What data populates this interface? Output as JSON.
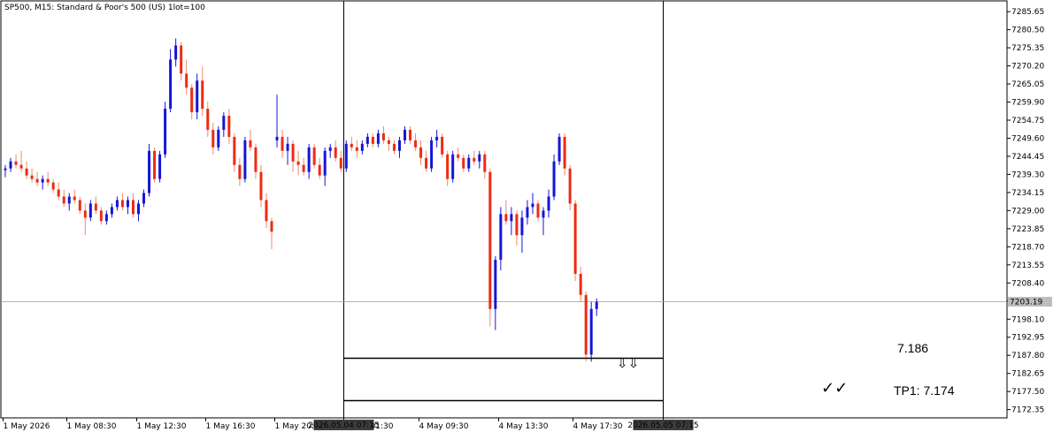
{
  "header": {
    "title": "SP500, M15:  Standard & Poor's 500 (US) 1lot=100"
  },
  "chart_data": {
    "type": "candlestick",
    "timeframe": "M15",
    "ylim": [
      7170.0,
      7288.7
    ],
    "y_ticks": [
      "7285.65",
      "7280.50",
      "7275.35",
      "7270.20",
      "7265.05",
      "7259.90",
      "7254.75",
      "7249.60",
      "7244.45",
      "7239.30",
      "7234.15",
      "7229.00",
      "7223.85",
      "7218.70",
      "7213.55",
      "7208.40",
      "7203.25",
      "7198.10",
      "7192.95",
      "7187.80",
      "7182.65",
      "7177.50",
      "7172.35"
    ],
    "x_ticks": [
      "1 May 2026",
      "1 May 08:30",
      "1 May 12:30",
      "1 May 16:30",
      "1 May 20:30",
      "4 May 01:30",
      "2026.05.04 07:15",
      "4 May 09:30",
      "4 May 13:30",
      "4 May 17:30",
      "2026.05.05 07:15"
    ],
    "current_price": "7203.19",
    "annotations": {
      "level_label": "7.186",
      "tp_label": "TP1: 7.174",
      "checkmarks": "✓✓",
      "arrows": "⇩⇩"
    },
    "levels": {
      "entry": 7187.0,
      "tp1": 7175.0
    },
    "colors": {
      "bull": "#1515d8",
      "bear": "#ee2b12",
      "bear_wick": "#ee8a6a",
      "axis": "#000000"
    },
    "candles": [
      [
        7240.5,
        7242,
        7238.5,
        7241
      ],
      [
        7241,
        7244,
        7240,
        7243
      ],
      [
        7243,
        7245,
        7241,
        7242
      ],
      [
        7242,
        7246,
        7240,
        7241
      ],
      [
        7241,
        7243,
        7238,
        7239
      ],
      [
        7239,
        7241,
        7237,
        7238
      ],
      [
        7238,
        7240,
        7236,
        7237
      ],
      [
        7237,
        7239,
        7235,
        7238
      ],
      [
        7238,
        7240,
        7236,
        7237
      ],
      [
        7237,
        7238,
        7234,
        7235
      ],
      [
        7235,
        7237,
        7232,
        7233
      ],
      [
        7233,
        7235,
        7230,
        7231
      ],
      [
        7231,
        7234,
        7229,
        7233
      ],
      [
        7233,
        7235,
        7231,
        7232
      ],
      [
        7232,
        7233,
        7228,
        7229
      ],
      [
        7229,
        7231,
        7222,
        7227
      ],
      [
        7227,
        7232,
        7226,
        7231
      ],
      [
        7231,
        7233,
        7228,
        7229
      ],
      [
        7229,
        7230,
        7225,
        7226
      ],
      [
        7226,
        7229,
        7225,
        7228
      ],
      [
        7228,
        7231,
        7227,
        7230
      ],
      [
        7230,
        7233,
        7229,
        7232
      ],
      [
        7232,
        7234,
        7229,
        7230
      ],
      [
        7230,
        7233,
        7228,
        7232
      ],
      [
        7232,
        7234,
        7227,
        7228
      ],
      [
        7228,
        7232,
        7226,
        7231
      ],
      [
        7231,
        7235,
        7230,
        7234
      ],
      [
        7234,
        7248,
        7233,
        7246
      ],
      [
        7246,
        7247,
        7237,
        7238
      ],
      [
        7238,
        7246,
        7237,
        7245
      ],
      [
        7245,
        7260,
        7244,
        7258
      ],
      [
        7258,
        7275,
        7257,
        7272
      ],
      [
        7272,
        7278,
        7270,
        7276
      ],
      [
        7276,
        7277,
        7266,
        7268
      ],
      [
        7268,
        7272,
        7262,
        7264
      ],
      [
        7264,
        7265,
        7255,
        7257
      ],
      [
        7257,
        7268,
        7255,
        7266
      ],
      [
        7266,
        7270,
        7256,
        7258
      ],
      [
        7258,
        7260,
        7250,
        7252
      ],
      [
        7252,
        7254,
        7245,
        7247
      ],
      [
        7247,
        7253,
        7246,
        7252
      ],
      [
        7252,
        7257,
        7250,
        7256
      ],
      [
        7256,
        7258,
        7248,
        7250
      ],
      [
        7250,
        7251,
        7240,
        7242
      ],
      [
        7242,
        7244,
        7236,
        7238
      ],
      [
        7238,
        7250,
        7237,
        7249
      ],
      [
        7249,
        7252,
        7246,
        7247
      ],
      [
        7247,
        7248,
        7238,
        7240
      ],
      [
        7240,
        7242,
        7230,
        7232
      ],
      [
        7232,
        7234,
        7224,
        7226
      ],
      [
        7226,
        7227,
        7218,
        7223
      ],
      [
        7249,
        7262,
        7247,
        7250
      ],
      [
        7250,
        7252,
        7244,
        7246
      ],
      [
        7246,
        7250,
        7242,
        7248
      ],
      [
        7248,
        7249,
        7240,
        7243
      ],
      [
        7243,
        7246,
        7239,
        7242
      ],
      [
        7242,
        7244,
        7239,
        7240
      ],
      [
        7240,
        7248,
        7238,
        7247
      ],
      [
        7247,
        7248,
        7241,
        7242
      ],
      [
        7242,
        7244,
        7238,
        7239
      ],
      [
        7239,
        7247,
        7236,
        7246
      ],
      [
        7246,
        7248,
        7244,
        7247
      ],
      [
        7247,
        7249,
        7243,
        7244
      ],
      [
        7244,
        7246,
        7240,
        7241
      ],
      [
        7241,
        7249,
        7240,
        7248
      ],
      [
        7248,
        7250,
        7246,
        7247
      ],
      [
        7247,
        7249,
        7244,
        7246
      ],
      [
        7246,
        7249,
        7245,
        7248
      ],
      [
        7248,
        7251,
        7247,
        7250
      ],
      [
        7250,
        7251,
        7247,
        7248
      ],
      [
        7248,
        7252,
        7247,
        7251
      ],
      [
        7251,
        7253,
        7248,
        7249
      ],
      [
        7249,
        7250,
        7246,
        7248
      ],
      [
        7248,
        7249,
        7245,
        7246
      ],
      [
        7246,
        7250,
        7244,
        7249
      ],
      [
        7249,
        7253,
        7248,
        7252
      ],
      [
        7252,
        7253,
        7248,
        7249
      ],
      [
        7249,
        7251,
        7246,
        7247
      ],
      [
        7247,
        7249,
        7242,
        7244
      ],
      [
        7244,
        7246,
        7240,
        7241
      ],
      [
        7241,
        7250,
        7240,
        7249
      ],
      [
        7249,
        7252,
        7247,
        7250
      ],
      [
        7250,
        7251,
        7244,
        7245
      ],
      [
        7245,
        7246,
        7236,
        7238
      ],
      [
        7238,
        7246,
        7237,
        7245
      ],
      [
        7245,
        7247,
        7243,
        7244
      ],
      [
        7244,
        7245,
        7240,
        7241
      ],
      [
        7241,
        7245,
        7240,
        7244
      ],
      [
        7244,
        7246,
        7242,
        7243
      ],
      [
        7243,
        7246,
        7241,
        7245
      ],
      [
        7245,
        7246,
        7238,
        7240
      ],
      [
        7240,
        7241,
        7196,
        7201
      ],
      [
        7201,
        7216,
        7195,
        7215
      ],
      [
        7215,
        7230,
        7212,
        7228
      ],
      [
        7228,
        7232,
        7225,
        7226
      ],
      [
        7226,
        7230,
        7222,
        7228
      ],
      [
        7228,
        7229,
        7219,
        7222
      ],
      [
        7222,
        7229,
        7217,
        7227
      ],
      [
        7227,
        7232,
        7225,
        7230
      ],
      [
        7230,
        7234,
        7228,
        7231
      ],
      [
        7231,
        7232,
        7226,
        7227
      ],
      [
        7227,
        7230,
        7222,
        7229
      ],
      [
        7229,
        7235,
        7227,
        7233
      ],
      [
        7233,
        7245,
        7232,
        7243
      ],
      [
        7243,
        7251,
        7242,
        7250
      ],
      [
        7250,
        7251,
        7239,
        7241
      ],
      [
        7241,
        7242,
        7229,
        7231
      ],
      [
        7231,
        7232,
        7209,
        7211
      ],
      [
        7211,
        7213,
        7203,
        7205
      ],
      [
        7205,
        7206,
        7186,
        7188
      ],
      [
        7188,
        7203,
        7186,
        7201
      ],
      [
        7201,
        7204,
        7199,
        7203
      ]
    ],
    "vline_indices": [
      64,
      124
    ],
    "gap_index": 51
  }
}
